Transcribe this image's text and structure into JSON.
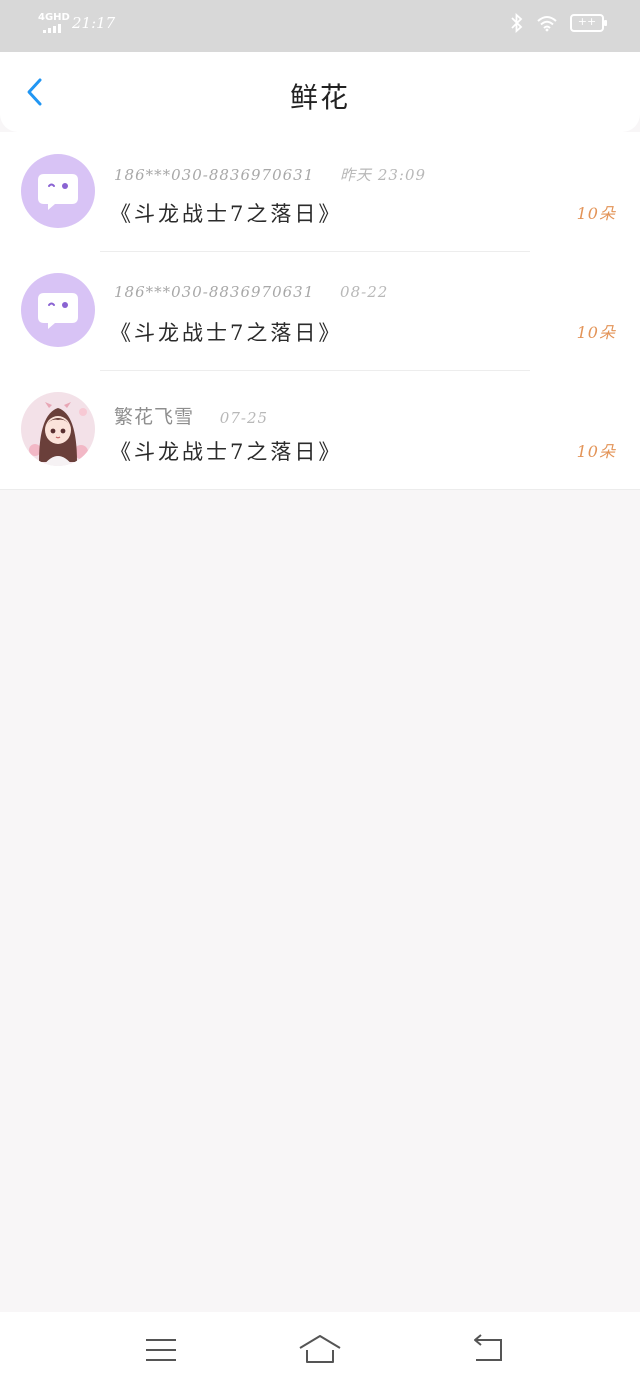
{
  "status_bar": {
    "network": "4GHD",
    "time": "21:17",
    "battery": "++"
  },
  "header": {
    "title": "鲜花",
    "back_icon": "chevron-left-icon"
  },
  "records": [
    {
      "avatar": "chat-bubble-avatar",
      "sender": "186***030-8836970631",
      "time": "昨天 23:09",
      "book": "《斗龙战士7之落日》",
      "count": "10朵"
    },
    {
      "avatar": "chat-bubble-avatar",
      "sender": "186***030-8836970631",
      "time": "08-22",
      "book": "《斗龙战士7之落日》",
      "count": "10朵"
    },
    {
      "avatar": "anime-girl-avatar",
      "sender": "繁花飞雪",
      "time": "07-25",
      "book": "《斗龙战士7之落日》",
      "count": "10朵"
    }
  ],
  "nav_bar": {
    "menu_icon": "menu-icon",
    "home_icon": "home-icon",
    "back_icon": "back-icon"
  },
  "colors": {
    "accent": "#2196f3",
    "count": "#e39458",
    "avatar_bg": "#d8c3f5"
  }
}
